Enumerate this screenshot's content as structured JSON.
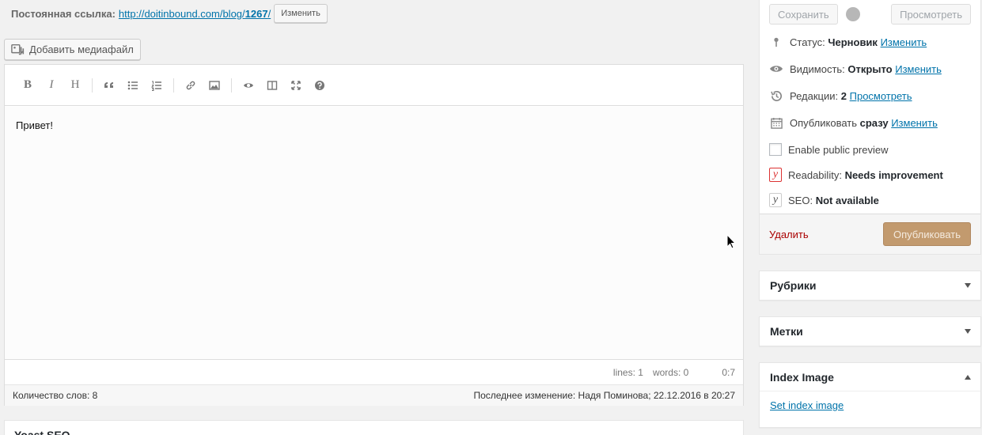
{
  "permalink": {
    "label": "Постоянная ссылка:",
    "url_base": "http://doitinbound.com/blog/",
    "url_slug": "1267",
    "url_tail": "/",
    "edit_button": "Изменить"
  },
  "media": {
    "add_button": "Добавить медиафайл"
  },
  "editor": {
    "toolbar": [
      {
        "name": "bold",
        "glyph": "B"
      },
      {
        "name": "italic",
        "glyph": "I"
      },
      {
        "name": "heading",
        "glyph": "H"
      },
      {
        "name": "quote",
        "glyph": "“"
      }
    ],
    "content": "Привет!",
    "status": {
      "lines": "lines: 1",
      "words": "words: 0",
      "position": "0:7"
    },
    "word_count": "Количество слов: 8",
    "last_edit": "Последнее изменение: Надя Поминова; 22.12.2016 в 20:27"
  },
  "yoast_box": {
    "title": "Yoast SEO"
  },
  "publish": {
    "save_button": "Сохранить",
    "preview_button": "Просмотреть",
    "status": {
      "label": "Статус:",
      "value": "Черновик",
      "link": "Изменить"
    },
    "visibility": {
      "label": "Видимость:",
      "value": "Открыто",
      "link": "Изменить"
    },
    "revisions": {
      "label": "Редакции:",
      "value": "2",
      "link": "Просмотреть"
    },
    "schedule": {
      "label": "Опубликовать",
      "value": "сразу",
      "link": "Изменить"
    },
    "public_preview": "Enable public preview",
    "readability": {
      "label": "Readability:",
      "value": "Needs improvement"
    },
    "seo": {
      "label": "SEO:",
      "value": "Not available"
    },
    "delete_link": "Удалить",
    "publish_button": "Опубликовать"
  },
  "boxes": {
    "categories": "Рубрики",
    "tags": "Метки",
    "index_image": {
      "title": "Index Image",
      "link": "Set index image"
    }
  },
  "colors": {
    "link": "#0073aa",
    "publish_button": "#c29a6e",
    "delete": "#aa0000",
    "yoast_bad": "#dc3232"
  }
}
